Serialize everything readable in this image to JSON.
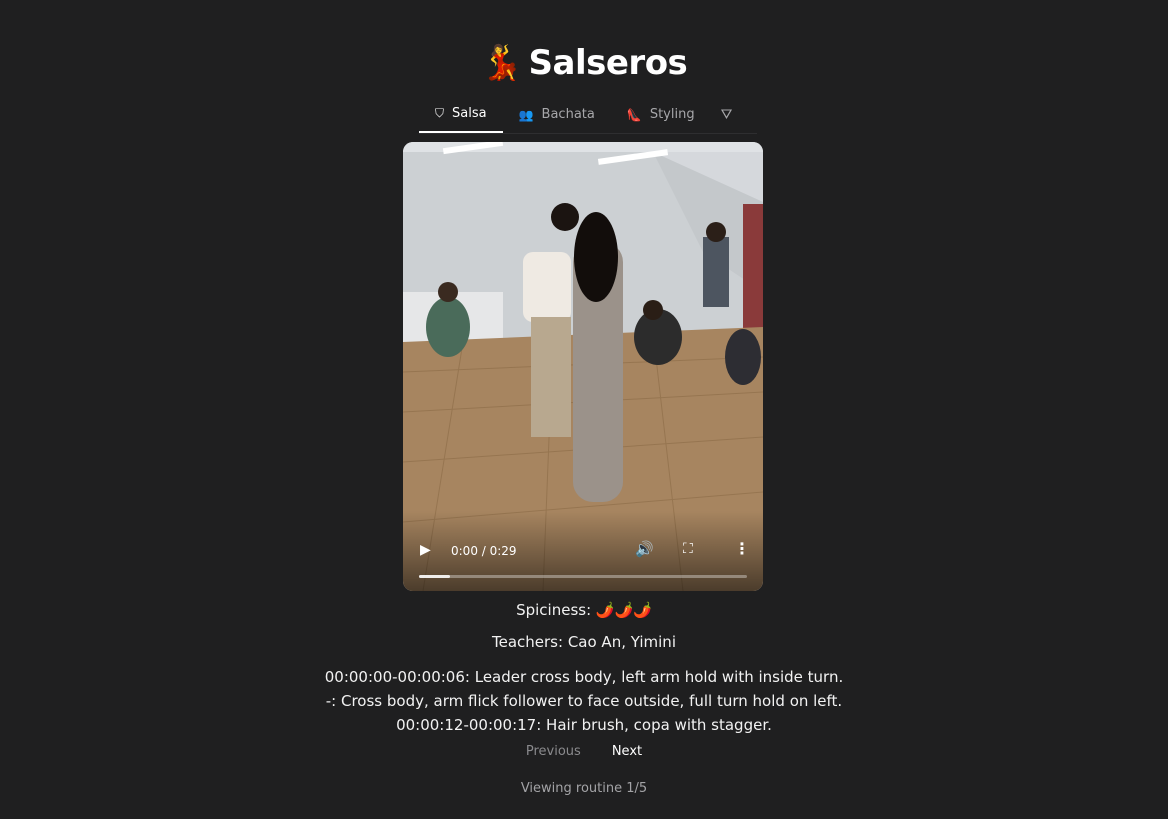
{
  "app": {
    "logo_emoji": "💃",
    "title": "Salseros"
  },
  "tabs": [
    {
      "icon": "salsa-icon",
      "glyph": "⛉",
      "label": "Salsa",
      "active": true
    },
    {
      "icon": "people-icon",
      "glyph": "👥",
      "label": "Bachata",
      "active": false
    },
    {
      "icon": "heel-icon",
      "glyph": "👠",
      "label": "Styling",
      "active": false
    }
  ],
  "filter": {
    "icon": "filter-icon",
    "glyph": "⛛"
  },
  "video": {
    "time": "0:00 / 0:29",
    "progress_fraction": 0.095,
    "play_glyph": "▶",
    "volume_glyph": "🔊",
    "fullscreen_glyph": "⛶",
    "more_glyph": "⋮"
  },
  "routine": {
    "spiciness": "Spiciness: 🌶️🌶️🌶️",
    "teachers": "Teachers: Cao An, Yimini",
    "steps": [
      "00:00:00-00:00:06: Leader cross body, left arm hold with inside turn.",
      "-: Cross body, arm flick follower to face outside, full turn hold on left.",
      "00:00:12-00:00:17: Hair brush, copa with stagger."
    ]
  },
  "pager": {
    "previous_label": "Previous",
    "next_label": "Next"
  },
  "status": "Viewing routine 1/5"
}
